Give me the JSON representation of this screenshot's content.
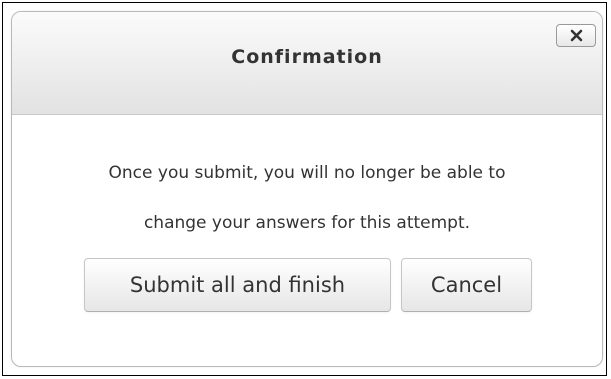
{
  "dialog": {
    "title": "Confirmation",
    "close_icon": "close-icon",
    "message_lines": [
      "Once you submit, you will no longer be able to",
      "change your answers for this attempt."
    ],
    "buttons": {
      "submit_label": "Submit all and finish",
      "cancel_label": "Cancel"
    }
  }
}
